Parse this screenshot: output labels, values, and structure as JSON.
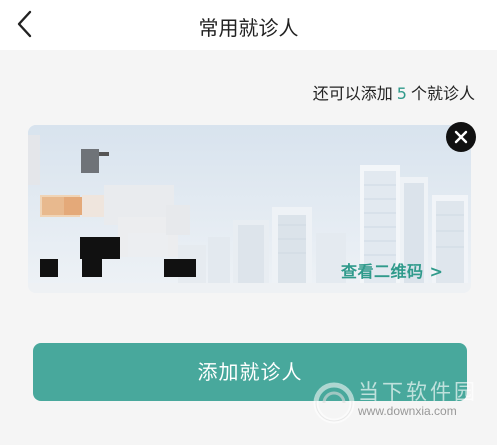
{
  "header": {
    "title": "常用就诊人",
    "back_icon": "chevron-left-icon"
  },
  "quota": {
    "prefix": "还可以添加",
    "count": "5",
    "suffix": "个就诊人"
  },
  "patient_card": {
    "qr_link_label": "查看二维码",
    "qr_link_arrow": ">",
    "close_icon": "close-circle-icon",
    "background": "city-skyline"
  },
  "add_button": {
    "label": "添加就诊人"
  },
  "watermark": {
    "text": "当下软件园",
    "url": "www.downxia.com"
  },
  "colors": {
    "accent": "#48a89c",
    "accent_text": "#2f9a8b"
  }
}
